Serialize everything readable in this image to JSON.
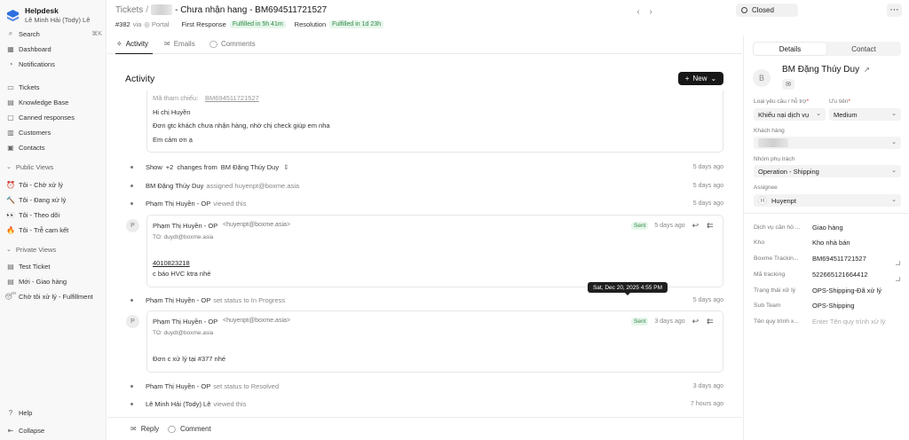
{
  "app": {
    "name": "Helpdesk",
    "user": "Lê Minh Hải (Tody) Lê"
  },
  "sidebar": {
    "search": {
      "label": "Search",
      "shortcut": "⌘K"
    },
    "items": [
      {
        "label": "Dashboard",
        "icon": "dashboard-icon"
      },
      {
        "label": "Notifications",
        "icon": "bell-icon"
      },
      {
        "label": "Tickets",
        "icon": "ticket-icon"
      },
      {
        "label": "Knowledge Base",
        "icon": "book-icon"
      },
      {
        "label": "Canned responses",
        "icon": "message-icon"
      },
      {
        "label": "Customers",
        "icon": "building-icon"
      },
      {
        "label": "Contacts",
        "icon": "contacts-icon"
      }
    ],
    "public_views_title": "Public Views",
    "public_views": [
      {
        "emoji": "⏰",
        "label": "Tôi - Chờ xử lý"
      },
      {
        "emoji": "🔨",
        "label": "Tôi - Đang xử lý"
      },
      {
        "emoji": "👀",
        "label": "Tôi - Theo dõi"
      },
      {
        "emoji": "🔥",
        "label": "Tôi - Trễ cam kết"
      }
    ],
    "private_views_title": "Private Views",
    "private_views": [
      {
        "emoji": "▤",
        "label": "Test Ticket"
      },
      {
        "emoji": "▤",
        "label": "Mới - Giao hàng"
      },
      {
        "emoji": "😴",
        "label": "Chờ tôi xử lý - Fulfillment"
      }
    ],
    "help": "Help",
    "collapse": "Collapse"
  },
  "header": {
    "breadcrumb_root": "Tickets",
    "breadcrumb_sep": "/",
    "title": "- Chưa nhận hang - BM694511721527",
    "ticket_id": "#382",
    "via": "via",
    "channel": "Portal",
    "first_response_label": "First Response",
    "first_response_status": "Fulfilled in 5h 41m",
    "resolution_label": "Resolution",
    "resolution_status": "Fulfilled in 1d 23h",
    "status": "Closed"
  },
  "tabs": [
    {
      "label": "Activity"
    },
    {
      "label": "Emails"
    },
    {
      "label": "Comments"
    }
  ],
  "activity": {
    "heading": "Activity",
    "new_button": "New",
    "top_card": {
      "lines": [
        "Mã tham chiếu:",
        "BM694511721527",
        "Hi chị Huyền",
        "Đơn gtc khách chưa nhận hàng, nhờ chị check giúp em nha",
        "Em cảm ơn ạ"
      ]
    },
    "show_changes": {
      "show": "Show",
      "count": "+2",
      "from": "changes from",
      "who": "BM Đặng Thúy Duy",
      "time": "5 days ago"
    },
    "events": [
      {
        "who": "BM Đặng Thúy Duy",
        "action": "assigned huyenpt@boxme.asia",
        "time": "5 days ago"
      },
      {
        "who": "Phạm Thị Huyền - OP",
        "action": "viewed this",
        "time": "5 days ago"
      },
      {
        "who": "Phạm Thị Huyền - OP",
        "action": "set status to In Progress",
        "time": "5 days ago"
      },
      {
        "who": "Phạm Thị Huyền - OP",
        "action": "set status to Resolved",
        "time": "3 days ago"
      },
      {
        "who": "Lê Minh Hải (Tody) Lê",
        "action": "viewed this",
        "time": "7 hours ago"
      }
    ],
    "emails": [
      {
        "avatar": "P",
        "sender": "Phạm Thị Huyền - OP",
        "email": "<huyenpt@boxme.asia>",
        "to": "TO: duydt@boxme.asia",
        "badge": "Sent",
        "time": "5 days ago",
        "body_link": "4010823218",
        "body": "c báo HVC ktra nhé"
      },
      {
        "avatar": "P",
        "sender": "Phạm Thị Huyền - OP",
        "email": "<huyenpt@boxme.asia>",
        "to": "TO: duydt@boxme.asia",
        "badge": "Sent",
        "time": "3 days ago",
        "body": "Đơn c xử lý tại #377 nhé"
      }
    ],
    "tooltip": "Sat, Dec 20, 2025 4:55 PM"
  },
  "footer": {
    "reply": "Reply",
    "comment": "Comment"
  },
  "panel": {
    "tabs": [
      "Details",
      "Contact"
    ],
    "contact": {
      "avatar": "B",
      "name": "BM Đặng Thúy Duy"
    },
    "fields": {
      "request_type": {
        "label": "Loại yêu cầu / hỗ trợ",
        "value": "Khiếu nại dịch vụ"
      },
      "priority": {
        "label": "Ưu tiên",
        "value": "Medium"
      },
      "customer": {
        "label": "Khách hàng"
      },
      "team": {
        "label": "Nhóm phụ trách",
        "value": "Operation - Shipping"
      },
      "assignee": {
        "label": "Assignee",
        "badge": "H",
        "value": "Huyenpt"
      }
    },
    "details": [
      {
        "label": "Dịch vụ cần hỗ ...",
        "value": "Giao hàng"
      },
      {
        "label": "Kho",
        "value": "Kho nhà bán"
      },
      {
        "label": "Boxme Trackin...",
        "value": "BM694511721527"
      },
      {
        "label": "Mã tracking",
        "value": "522665121664412"
      },
      {
        "label": "Trạng thái xử lý",
        "value": "OPS-Shipping-Đã xử lý"
      },
      {
        "label": "Sub Team",
        "value": "OPS-Shipping"
      },
      {
        "label": "Tên quy trình x...",
        "placeholder": "Enter Tên quy trình xử lý"
      }
    ]
  }
}
